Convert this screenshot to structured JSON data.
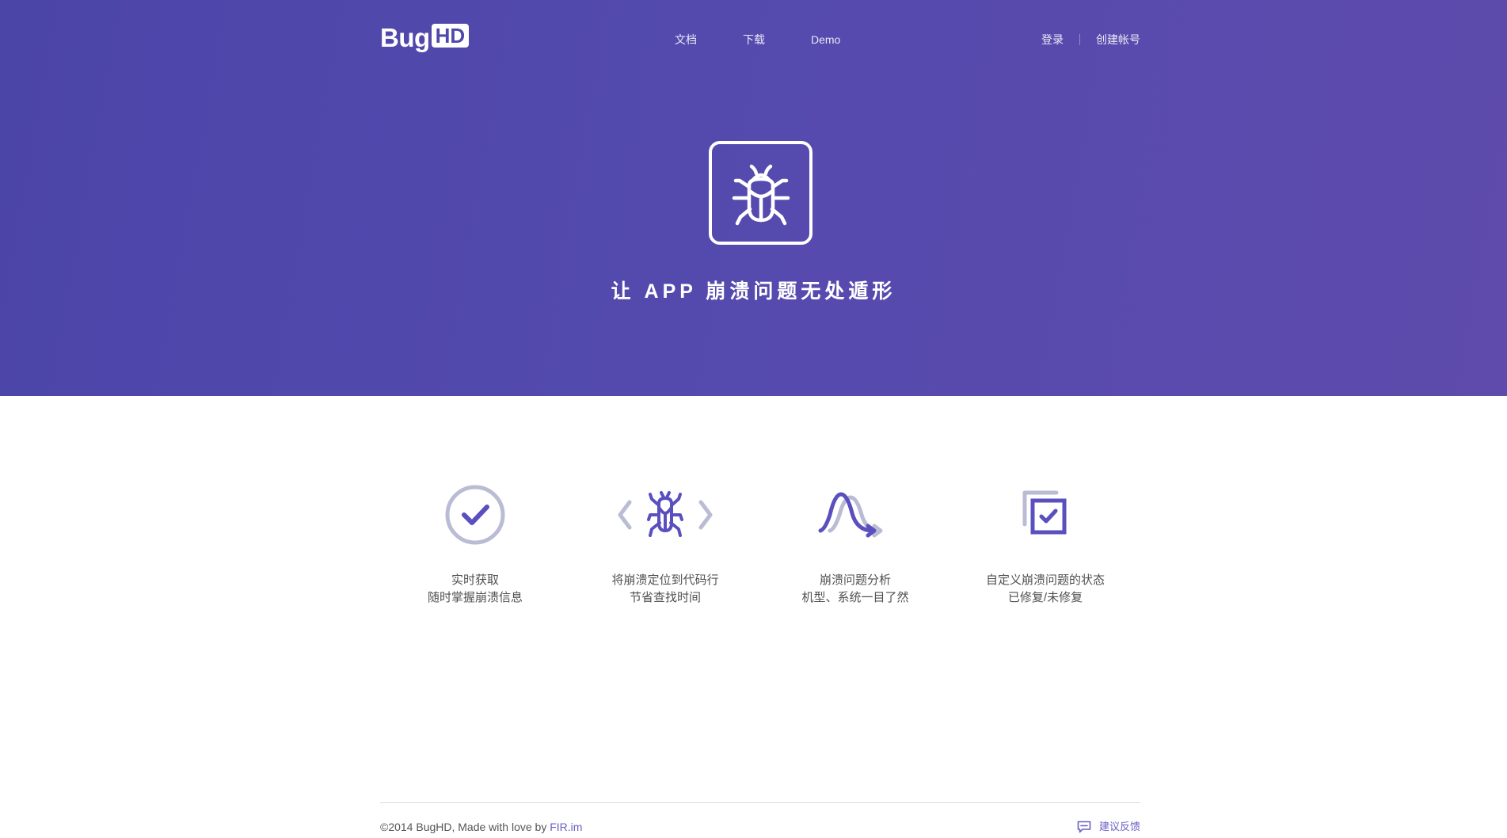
{
  "nav": {
    "logo_text": "Bug",
    "logo_badge": "HD",
    "links": [
      "文档",
      "下载",
      "Demo"
    ],
    "login": "登录",
    "signup": "创建帐号"
  },
  "hero": {
    "icon": "bug-icon",
    "slogan": "让 APP 崩溃问题无处遁形"
  },
  "features": [
    {
      "icon": "check-circle-icon",
      "line1": "实时获取",
      "line2": "随时掌握崩溃信息"
    },
    {
      "icon": "code-bug-icon",
      "line1": "将崩溃定位到代码行",
      "line2": "节省查找时间"
    },
    {
      "icon": "wave-chart-icon",
      "line1": "崩溃问题分析",
      "line2": "机型、系统一目了然"
    },
    {
      "icon": "checkbox-stack-icon",
      "line1": "自定义崩溃问题的状态",
      "line2": "已修复/未修复"
    }
  ],
  "footer": {
    "copyright": "©2014 BugHD, Made with love by ",
    "link_text": "FIR.im",
    "feedback_icon": "chat-bubble-icon",
    "feedback": "建议反馈"
  },
  "colors": {
    "hero_bg": "#5049ad",
    "accent": "#5a4fbf",
    "icon_muted": "#b9bcd3",
    "footer_link": "#6a5fc6"
  }
}
